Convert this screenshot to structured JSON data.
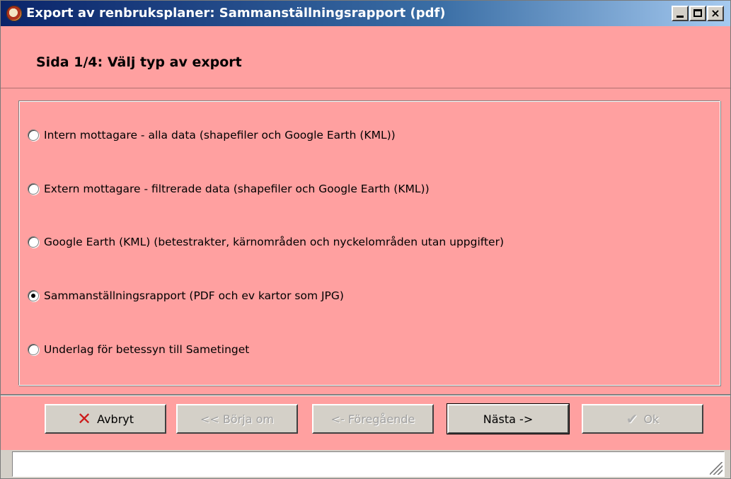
{
  "window": {
    "title": "Export av renbruksplaner: Sammanställningsrapport (pdf)",
    "minimize_label": "_",
    "close_label": "×"
  },
  "header": {
    "title": "Sida 1/4: Välj typ av export"
  },
  "options": [
    {
      "label": "Intern mottagare - alla data (shapefiler och Google Earth (KML))",
      "checked": false
    },
    {
      "label": "Extern mottagare - filtrerade data (shapefiler och Google Earth (KML))",
      "checked": false
    },
    {
      "label": "Google Earth (KML) (betestrakter, kärnområden och nyckelområden utan uppgifter)",
      "checked": false
    },
    {
      "label": "Sammanställningsrapport (PDF och ev kartor som JPG)",
      "checked": true
    },
    {
      "label": "Underlag för betessyn till Sametinget",
      "checked": false
    }
  ],
  "buttons": {
    "cancel": {
      "label": "Avbryt",
      "icon": "red-x-icon",
      "enabled": true
    },
    "restart": {
      "label": "<< Börja om",
      "enabled": false
    },
    "previous": {
      "label": "<- Föregående",
      "enabled": false
    },
    "next": {
      "label": "Nästa ->",
      "enabled": true
    },
    "ok": {
      "label": "Ok",
      "icon": "checkmark-icon",
      "enabled": false
    }
  },
  "statusbar": {
    "text": ""
  },
  "colors": {
    "panel": "#ffa0a0",
    "titlebar_start": "#0a246a",
    "titlebar_end": "#a6caf0",
    "cancel_icon": "#cc1a1a"
  }
}
